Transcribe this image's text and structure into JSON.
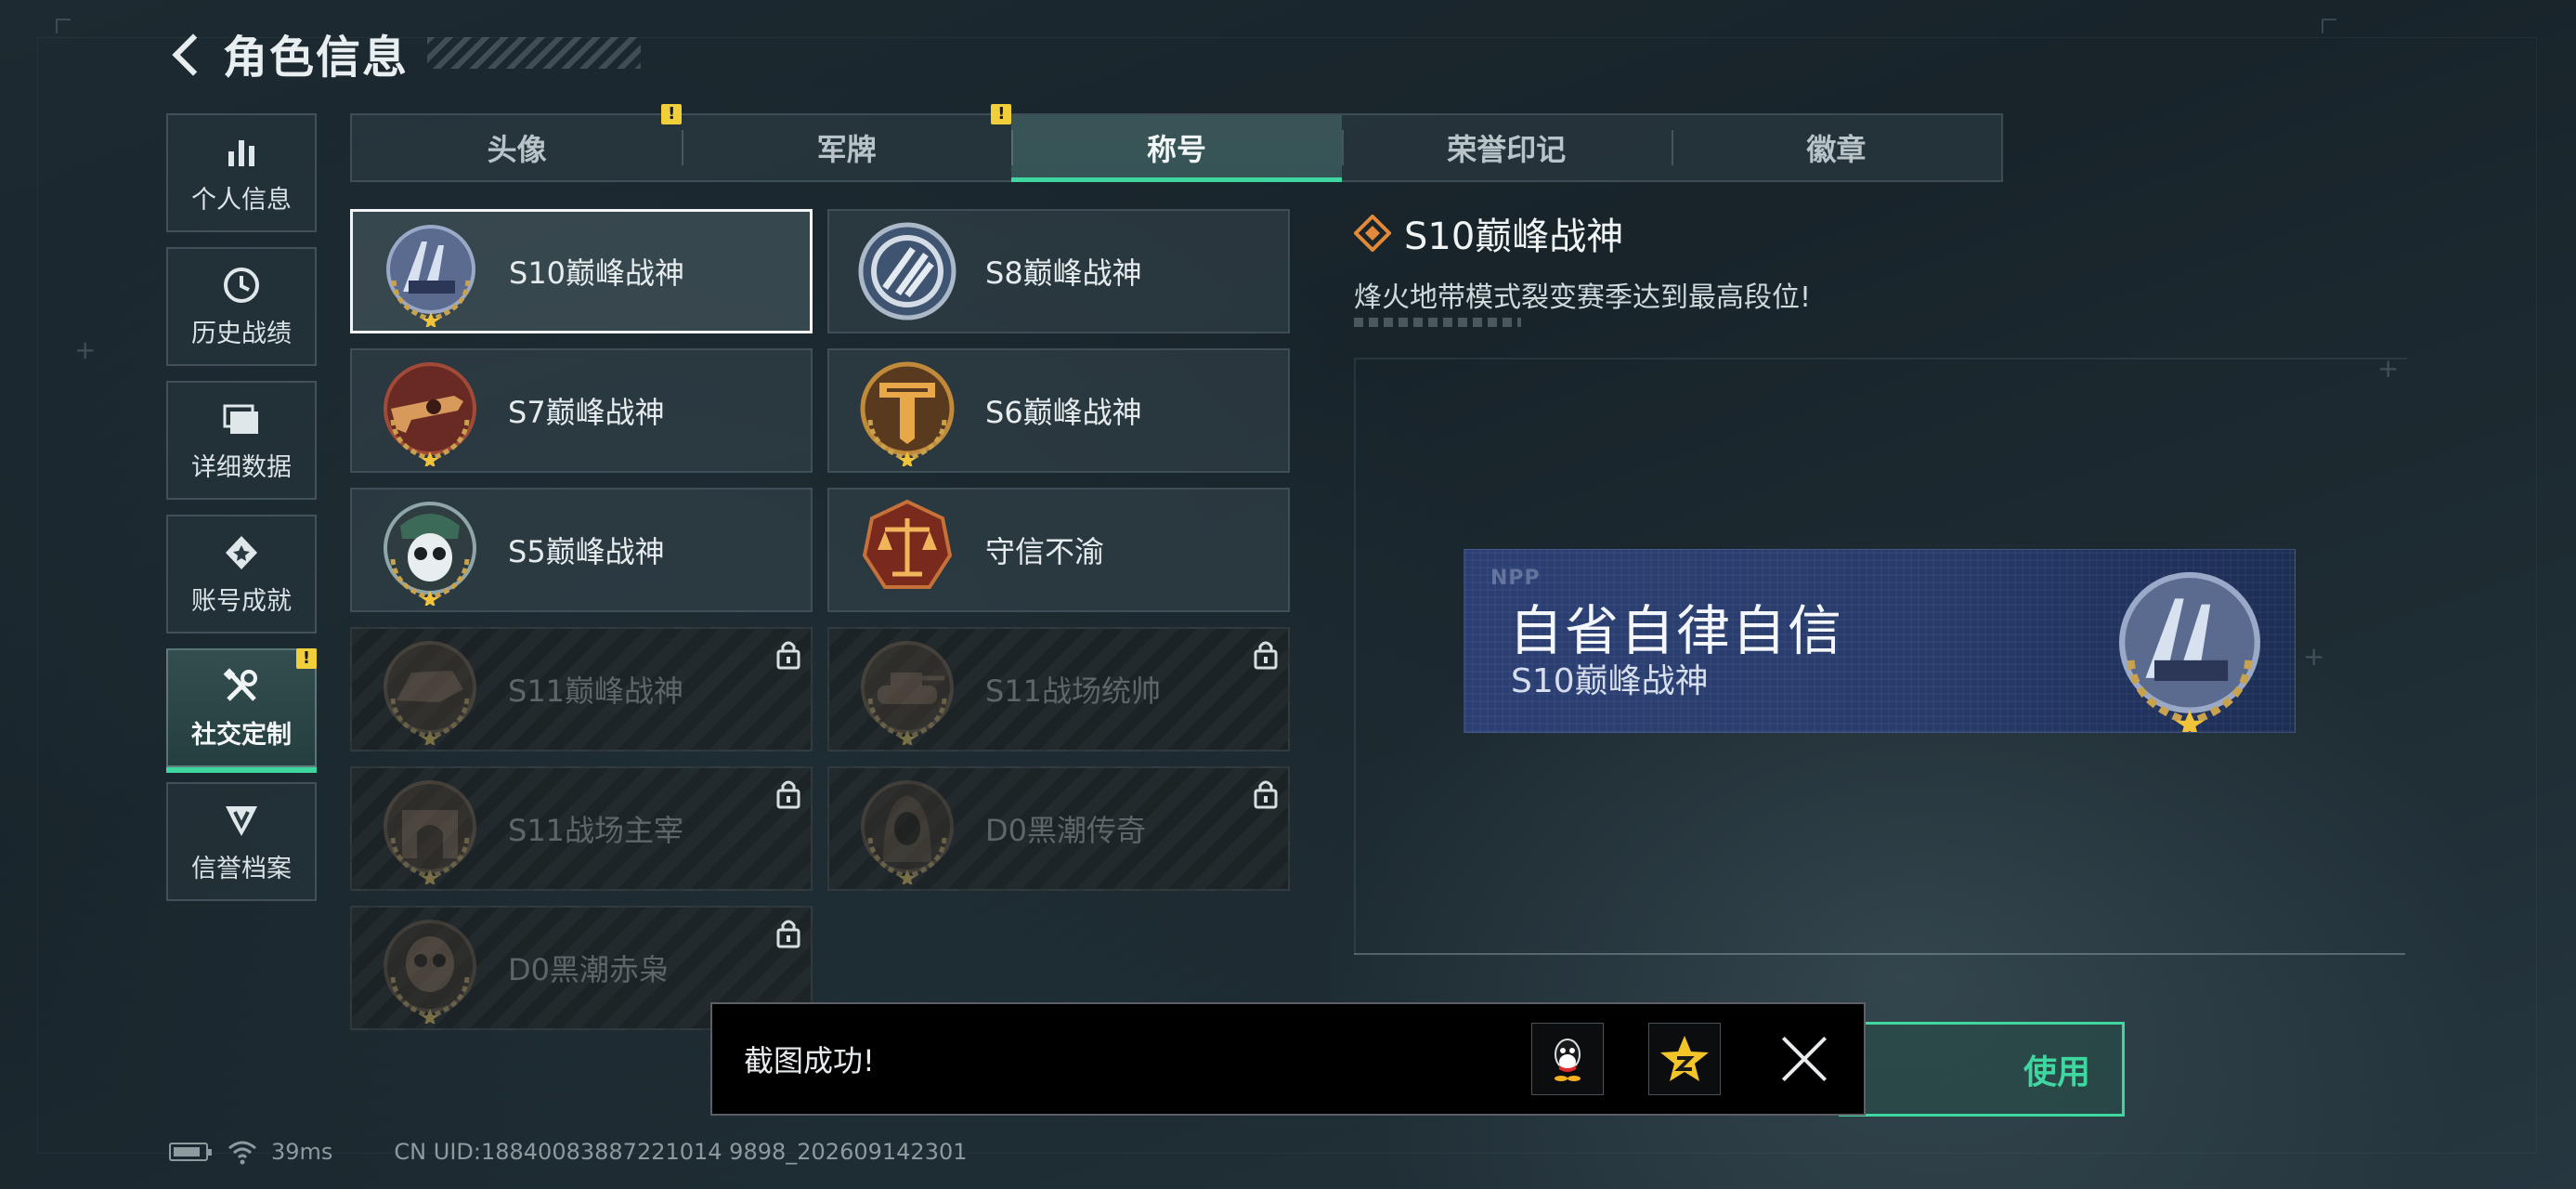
{
  "header": {
    "title": "角色信息"
  },
  "nav": {
    "items": [
      {
        "label": "个人信息",
        "icon": "bar-chart-icon",
        "active": false
      },
      {
        "label": "历史战绩",
        "icon": "clock-icon",
        "active": false
      },
      {
        "label": "详细数据",
        "icon": "folder-icon",
        "active": false
      },
      {
        "label": "账号成就",
        "icon": "achievement-icon",
        "active": false
      },
      {
        "label": "社交定制",
        "icon": "tools-icon",
        "active": true,
        "badge": "!"
      },
      {
        "label": "信誉档案",
        "icon": "credit-shield-icon",
        "active": false
      }
    ]
  },
  "tabs": [
    {
      "label": "头像",
      "badge": "!"
    },
    {
      "label": "军牌",
      "badge": "!"
    },
    {
      "label": "称号",
      "active": true
    },
    {
      "label": "荣誉印记"
    },
    {
      "label": "徽章"
    }
  ],
  "titles": [
    {
      "name": "S10巅峰战神",
      "selected": true,
      "locked": false,
      "emblem": "s10-emblem"
    },
    {
      "name": "S8巅峰战神",
      "locked": false,
      "emblem": "s8-emblem"
    },
    {
      "name": "S7巅峰战神",
      "locked": false,
      "emblem": "s7-emblem"
    },
    {
      "name": "S6巅峰战神",
      "locked": false,
      "emblem": "s6-emblem"
    },
    {
      "name": "S5巅峰战神",
      "locked": false,
      "emblem": "s5-emblem"
    },
    {
      "name": "守信不渝",
      "locked": false,
      "emblem": "scales-emblem"
    },
    {
      "name": "S11巅峰战神",
      "locked": true,
      "emblem": "s11-peak-emblem"
    },
    {
      "name": "S11战场统帅",
      "locked": true,
      "emblem": "s11-tank-emblem"
    },
    {
      "name": "S11战场主宰",
      "locked": true,
      "emblem": "s11-arch-emblem"
    },
    {
      "name": "D0黑潮传奇",
      "locked": true,
      "emblem": "d0-hood-emblem"
    },
    {
      "name": "D0黑潮赤枭",
      "locked": true,
      "emblem": "d0-skull-emblem"
    }
  ],
  "detail": {
    "name": "S10巅峰战神",
    "description": "烽火地带模式裂变赛季达到最高段位!",
    "nameplate": {
      "logo": "NPP",
      "main": "自省自律自信",
      "sub": "S10巅峰战神"
    },
    "use_button": "使用"
  },
  "toast": {
    "message": "截图成功!",
    "share_qq": "qq-icon",
    "share_qzone": "qzone-star-icon"
  },
  "footer": {
    "ping": "39ms",
    "uid": "CN UID:18840083887221014 9898_202609142301"
  },
  "colors": {
    "accent": "#3fd6a0",
    "warning": "#f1cf3a",
    "nameplate": "#2b3f74"
  }
}
